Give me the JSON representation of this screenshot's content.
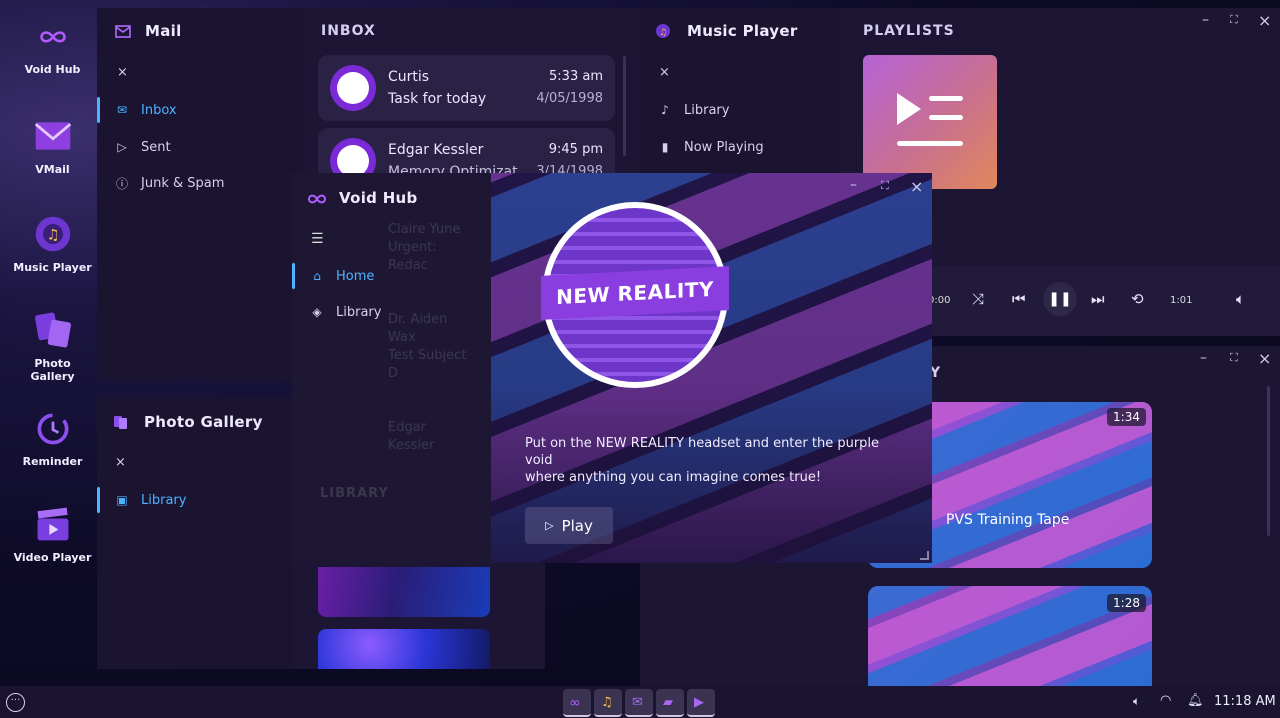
{
  "dock": {
    "items": [
      {
        "label": "Void Hub",
        "icon": "infinity-icon"
      },
      {
        "label": "VMail",
        "icon": "mail-icon"
      },
      {
        "label": "Music Player",
        "icon": "music-disc-icon"
      },
      {
        "label": "Photo Gallery",
        "icon": "photos-icon"
      },
      {
        "label": "Reminder",
        "icon": "alarm-clock-icon"
      },
      {
        "label": "Video Player",
        "icon": "clapperboard-icon"
      }
    ]
  },
  "mail": {
    "title": "Mail",
    "close": "×",
    "nav": [
      "Inbox",
      "Sent",
      "Junk & Spam"
    ],
    "list_title": "INBOX",
    "messages": [
      {
        "name": "Curtis",
        "subject": "Task for today",
        "time": "5:33 am",
        "date": "4/05/1998"
      },
      {
        "name": "Edgar Kessler",
        "subject": "Memory Optimizat",
        "time": "9:45 pm",
        "date": "3/14/1998"
      }
    ],
    "faded": [
      "Claire Yune",
      "Urgent: Redac",
      "Dr. Aiden Wax",
      "Test Subject D",
      "Edgar Kessler"
    ]
  },
  "music": {
    "title": "Music Player",
    "close": "×",
    "nav": [
      "Library",
      "Now Playing"
    ],
    "playlists_title": "PLAYLISTS",
    "time_elapsed": "0:00",
    "time_total": "1:01",
    "window_controls": [
      "–",
      "⛶",
      "×"
    ]
  },
  "gallery": {
    "title": "Photo Gallery",
    "close": "×",
    "nav": [
      "Library"
    ],
    "faded_library": "LIBRARY"
  },
  "voidhub": {
    "title": "Void Hub",
    "nav": [
      "Home",
      "Library"
    ],
    "window_controls": [
      "–",
      "⛶",
      "×"
    ],
    "logo_text": "NEW REALITY",
    "description_line1": "Put on the NEW REALITY headset and enter the purple void",
    "description_line2": "where anything you can imagine comes true!",
    "play_label": "Play"
  },
  "video": {
    "title_partial": "Y",
    "window_controls": [
      "–",
      "⛶",
      "×"
    ],
    "videos": [
      {
        "title": "PVS Training Tape",
        "duration": "1:34"
      },
      {
        "title": "",
        "duration": "1:28"
      }
    ]
  },
  "taskbar": {
    "time": "11:18 AM"
  },
  "colors": {
    "accent": "#4db3ff",
    "window": "#1d1635",
    "sidebar": "#1a1430"
  }
}
